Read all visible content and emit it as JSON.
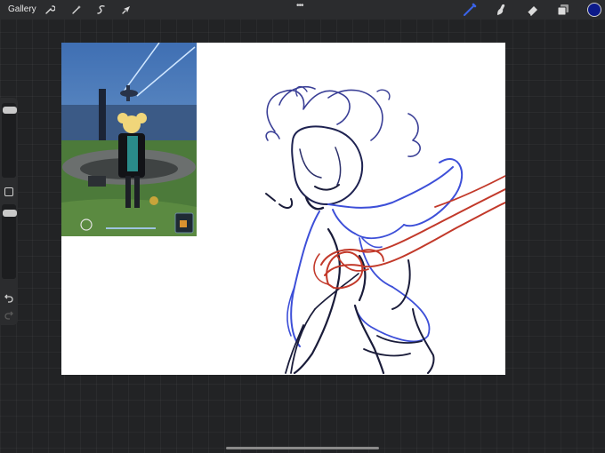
{
  "topbar": {
    "gallery_label": "Gallery",
    "left_tools": [
      "wrench-icon",
      "magic-wand-icon",
      "selection-icon",
      "transform-icon"
    ],
    "center_menu": "•••",
    "right_tools": [
      "brush-icon",
      "smudge-icon",
      "eraser-icon",
      "layers-icon"
    ],
    "current_color": "#0c1a8a"
  },
  "sidebar": {
    "brush_size_level": 0.08,
    "opacity_level": 0.12,
    "modify_button": "square-modify-icon",
    "undo": "undo-icon",
    "redo": "redo-icon"
  },
  "canvas": {
    "background": "#ffffff",
    "reference_image": "game-screenshot-character",
    "sketch_colors": [
      "#2b3a8f",
      "#3d4fd8",
      "#c2392a",
      "#1a1c3a"
    ]
  },
  "accent": "#3a63e8"
}
